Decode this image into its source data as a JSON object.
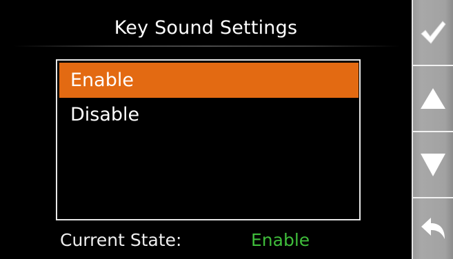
{
  "screen": {
    "title": "Key Sound Settings"
  },
  "options": [
    {
      "label": "Enable",
      "selected": true
    },
    {
      "label": "Disable",
      "selected": false
    }
  ],
  "status": {
    "label": "Current State:",
    "value": "Enable",
    "value_color": "#3fbd3b"
  },
  "colors": {
    "selection": "#e36a12",
    "side_panel": "#a8a8a8"
  },
  "side_buttons": [
    {
      "icon": "checkmark-icon",
      "action": "confirm"
    },
    {
      "icon": "arrow-up-icon",
      "action": "up"
    },
    {
      "icon": "arrow-down-icon",
      "action": "down"
    },
    {
      "icon": "back-arrow-icon",
      "action": "back"
    }
  ]
}
